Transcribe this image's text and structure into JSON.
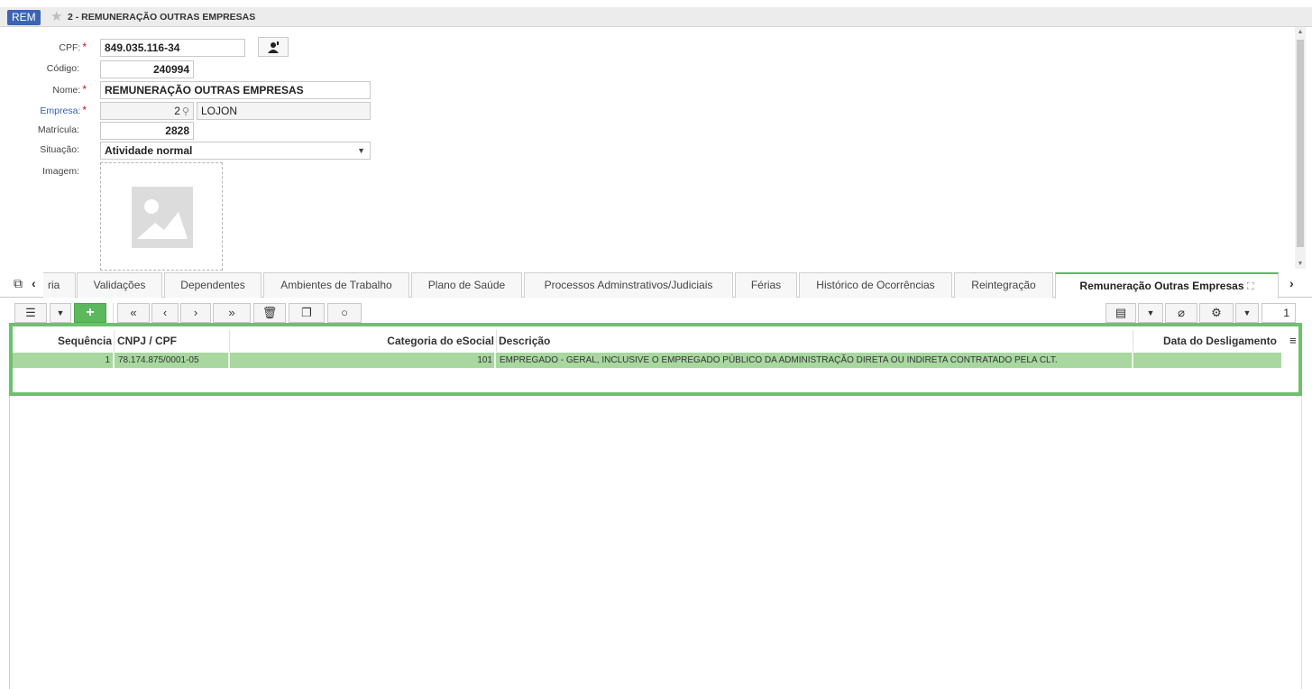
{
  "window": {
    "badge": "REM",
    "title": "2 - REMUNERAÇÃO OUTRAS EMPRESAS"
  },
  "form": {
    "cpf": {
      "label": "CPF:",
      "value": "849.035.116-34"
    },
    "codigo": {
      "label": "Código:",
      "value": "240994"
    },
    "nome": {
      "label": "Nome:",
      "value": "REMUNERAÇÃO OUTRAS EMPRESAS"
    },
    "empresa": {
      "label": "Empresa:",
      "code": "2",
      "name": "LOJON"
    },
    "matricula": {
      "label": "Matrícula:",
      "value": "2828"
    },
    "situacao": {
      "label": "Situação:",
      "value": "Atividade normal"
    },
    "imagem": {
      "label": "Imagem:"
    },
    "required_mark": "*"
  },
  "tabs": [
    {
      "label": "ria"
    },
    {
      "label": "Validações"
    },
    {
      "label": "Dependentes"
    },
    {
      "label": "Ambientes de Trabalho"
    },
    {
      "label": "Plano de Saúde"
    },
    {
      "label": "Processos Adminstrativos/Judiciais"
    },
    {
      "label": "Férias"
    },
    {
      "label": "Histórico de Ocorrências"
    },
    {
      "label": "Reintegração"
    },
    {
      "label": "Remuneração Outras Empresas",
      "active": true
    }
  ],
  "toolbar": {
    "page": "1"
  },
  "grid": {
    "columns": [
      "Sequência",
      "CNPJ / CPF",
      "Categoria do eSocial",
      "Descrição",
      "Data do Desligamento"
    ],
    "rows": [
      {
        "sequencia": "1",
        "cnpj": "78.174.875/0001-05",
        "categoria": "101",
        "descricao": "EMPREGADO - GERAL, INCLUSIVE O EMPREGADO PÚBLICO DA ADMINISTRAÇÃO DIRETA OU INDIRETA CONTRATADO PELA CLT.",
        "data": ""
      }
    ]
  },
  "icons": {
    "star": "star-icon",
    "user": "user-icon",
    "search": "search-icon",
    "dropdown": "chevron-down-icon",
    "image": "image-placeholder-icon",
    "copy": "copy-icon",
    "list": "list-icon",
    "add": "plus-icon",
    "first": "double-chevron-left-icon",
    "prev": "chevron-left-icon",
    "next": "chevron-right-icon",
    "last": "double-chevron-right-icon",
    "delete": "trash-icon",
    "duplicate": "duplicate-icon",
    "refresh": "refresh-icon",
    "report": "document-icon",
    "attach": "paperclip-icon",
    "settings": "gear-icon",
    "expand": "expand-icon",
    "menu": "hamburger-icon"
  },
  "colors": {
    "accent": "#5cb85c",
    "selected_row": "#a8d8a0",
    "badge": "#3b64b4",
    "required": "#d01010",
    "link_label": "#2f5fb3"
  }
}
